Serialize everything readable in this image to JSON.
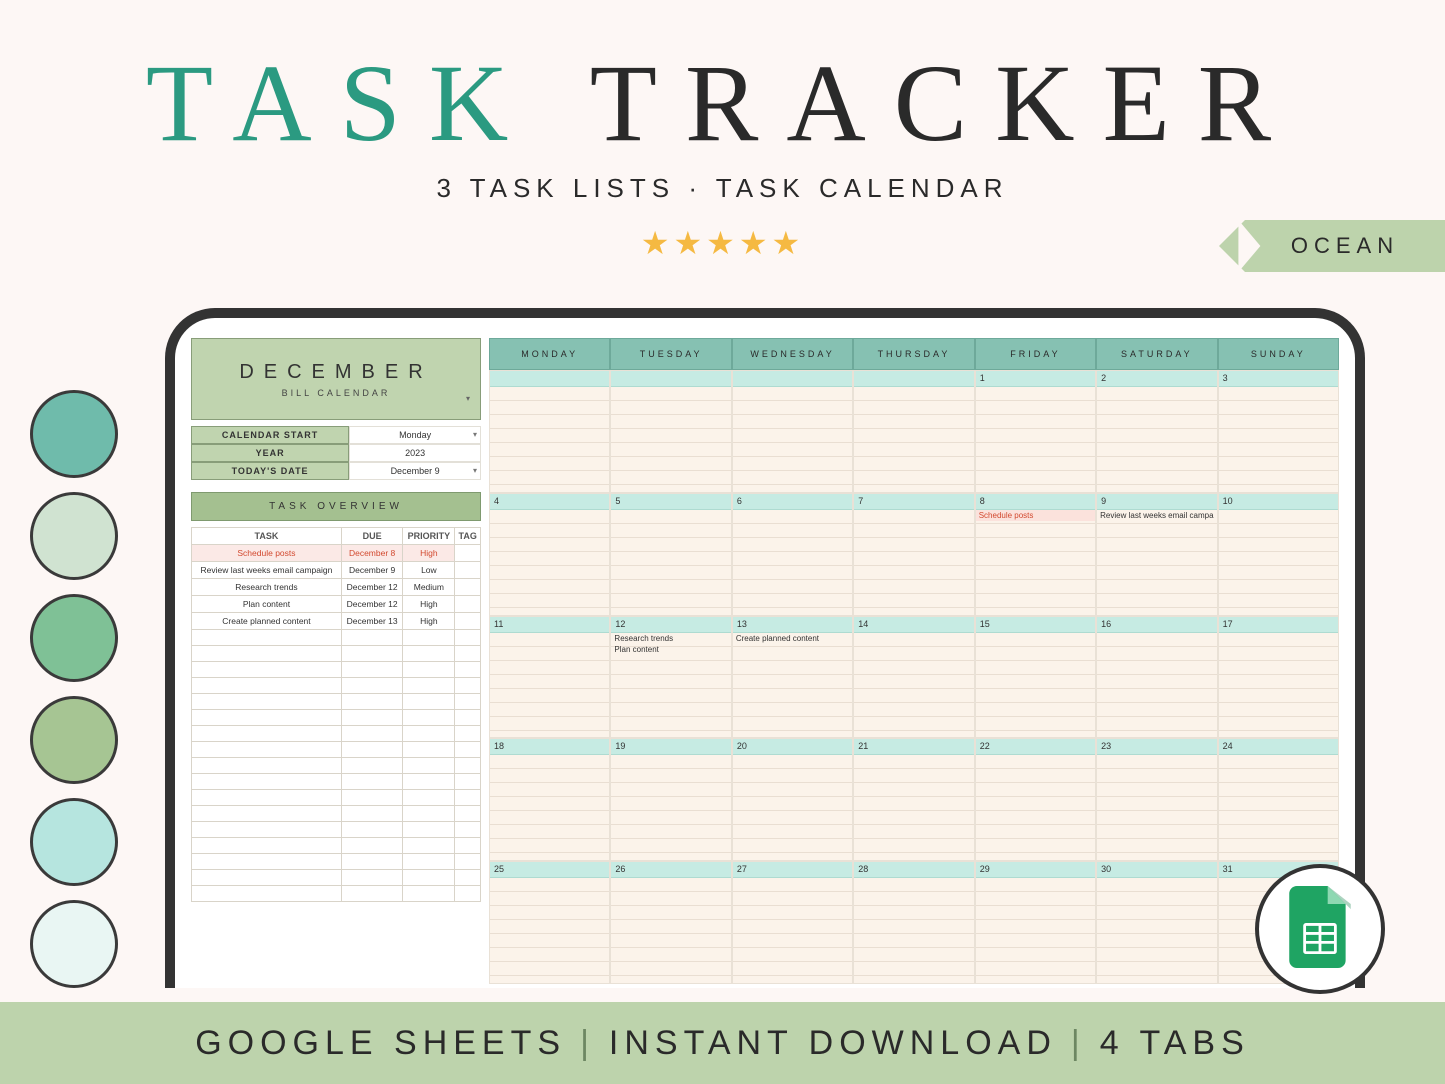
{
  "header": {
    "title_part1": "TASK",
    "title_part2": "TRACKER",
    "subtitle": "3 TASK LISTS · TASK CALENDAR",
    "stars": 5,
    "ribbon": "OCEAN"
  },
  "swatches": [
    "#6fbbab",
    "#d0e3d1",
    "#7fc196",
    "#a6c593",
    "#b6e5df",
    "#e9f6f3"
  ],
  "sidebar": {
    "month_box": {
      "title": "DECEMBER",
      "subtitle": "BILL CALENDAR"
    },
    "settings": [
      {
        "label": "CALENDAR START",
        "value": "Monday",
        "dropdown": true
      },
      {
        "label": "YEAR",
        "value": "2023",
        "dropdown": false
      },
      {
        "label": "TODAY'S DATE",
        "value": "December 9",
        "dropdown": true
      }
    ],
    "overview": {
      "heading": "TASK OVERVIEW",
      "columns": [
        "TASK",
        "DUE",
        "PRIORITY",
        "TAG"
      ],
      "rows": [
        {
          "task": "Schedule posts",
          "due": "December 8",
          "priority": "High",
          "tag": "",
          "high": true
        },
        {
          "task": "Review last weeks email campaign",
          "due": "December 9",
          "priority": "Low",
          "tag": "",
          "high": false
        },
        {
          "task": "Research trends",
          "due": "December 12",
          "priority": "Medium",
          "tag": "",
          "high": false
        },
        {
          "task": "Plan content",
          "due": "December 12",
          "priority": "High",
          "tag": "",
          "high": false
        },
        {
          "task": "Create planned content",
          "due": "December 13",
          "priority": "High",
          "tag": "",
          "high": false
        }
      ],
      "blank_rows": 17
    }
  },
  "calendar": {
    "day_headers": [
      "MONDAY",
      "TUESDAY",
      "WEDNESDAY",
      "THURSDAY",
      "FRIDAY",
      "SATURDAY",
      "SUNDAY"
    ],
    "weeks": [
      [
        {
          "num": "",
          "tasks": []
        },
        {
          "num": "",
          "tasks": []
        },
        {
          "num": "",
          "tasks": []
        },
        {
          "num": "",
          "tasks": []
        },
        {
          "num": "1",
          "tasks": []
        },
        {
          "num": "2",
          "tasks": []
        },
        {
          "num": "3",
          "tasks": []
        }
      ],
      [
        {
          "num": "4",
          "tasks": []
        },
        {
          "num": "5",
          "tasks": []
        },
        {
          "num": "6",
          "tasks": []
        },
        {
          "num": "7",
          "tasks": []
        },
        {
          "num": "8",
          "tasks": [
            {
              "text": "Schedule posts",
              "hot": true
            }
          ]
        },
        {
          "num": "9",
          "tasks": [
            {
              "text": "Review last weeks email campa",
              "hot": false
            }
          ]
        },
        {
          "num": "10",
          "tasks": []
        }
      ],
      [
        {
          "num": "11",
          "tasks": []
        },
        {
          "num": "12",
          "tasks": [
            {
              "text": "Research trends",
              "hot": false
            },
            {
              "text": "Plan content",
              "hot": false
            }
          ]
        },
        {
          "num": "13",
          "tasks": [
            {
              "text": "Create planned content",
              "hot": false
            }
          ]
        },
        {
          "num": "14",
          "tasks": []
        },
        {
          "num": "15",
          "tasks": []
        },
        {
          "num": "16",
          "tasks": []
        },
        {
          "num": "17",
          "tasks": []
        }
      ],
      [
        {
          "num": "18",
          "tasks": []
        },
        {
          "num": "19",
          "tasks": []
        },
        {
          "num": "20",
          "tasks": []
        },
        {
          "num": "21",
          "tasks": []
        },
        {
          "num": "22",
          "tasks": []
        },
        {
          "num": "23",
          "tasks": []
        },
        {
          "num": "24",
          "tasks": []
        }
      ],
      [
        {
          "num": "25",
          "tasks": []
        },
        {
          "num": "26",
          "tasks": []
        },
        {
          "num": "27",
          "tasks": []
        },
        {
          "num": "28",
          "tasks": []
        },
        {
          "num": "29",
          "tasks": []
        },
        {
          "num": "30",
          "tasks": []
        },
        {
          "num": "31",
          "tasks": []
        }
      ]
    ]
  },
  "footer": {
    "part1": "GOOGLE SHEETS",
    "part2": "INSTANT DOWNLOAD",
    "part3": "4 TABS"
  }
}
